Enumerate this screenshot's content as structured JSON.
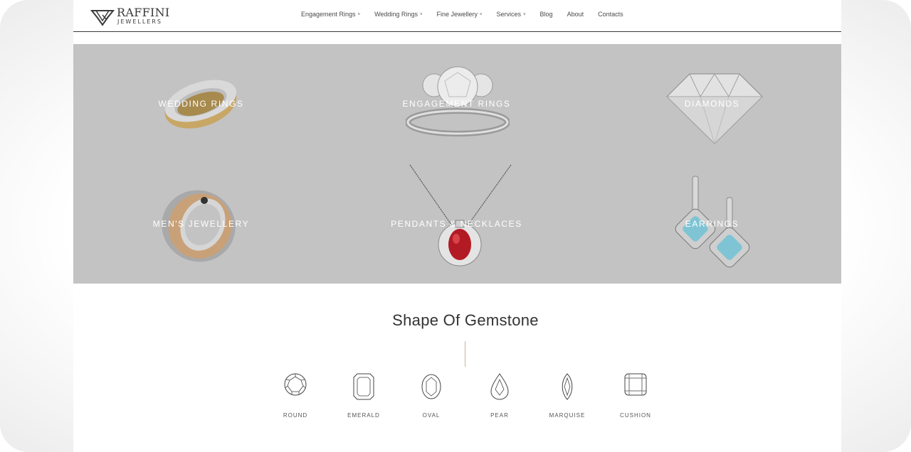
{
  "brand": {
    "name": "RAFFINI",
    "sub": "JEWELLERS"
  },
  "nav": {
    "items": [
      {
        "label": "Engagement Rings",
        "dropdown": true
      },
      {
        "label": "Wedding Rings",
        "dropdown": true
      },
      {
        "label": "Fine Jewellery",
        "dropdown": true
      },
      {
        "label": "Services",
        "dropdown": true
      },
      {
        "label": "Blog",
        "dropdown": false
      },
      {
        "label": "About",
        "dropdown": false
      },
      {
        "label": "Contacts",
        "dropdown": false
      }
    ],
    "caret": "˅"
  },
  "categories": [
    {
      "label": "WEDDING RINGS",
      "icon": "wedding-ring-image"
    },
    {
      "label": "ENGAGEMENT RINGS",
      "icon": "engagement-ring-image"
    },
    {
      "label": "DIAMONDS",
      "icon": "diamond-image"
    },
    {
      "label": "MEN'S JEWELLERY",
      "icon": "mens-ring-image"
    },
    {
      "label": "PENDANTS & NECKLACES",
      "icon": "ruby-pendant-image"
    },
    {
      "label": "EARRINGS",
      "icon": "blue-topaz-earrings-image"
    }
  ],
  "shapes_section": {
    "title": "Shape Of Gemstone",
    "shapes": [
      {
        "label": "ROUND",
        "icon": "round-cut-icon"
      },
      {
        "label": "EMERALD",
        "icon": "emerald-cut-icon"
      },
      {
        "label": "OVAL",
        "icon": "oval-cut-icon"
      },
      {
        "label": "PEAR",
        "icon": "pear-cut-icon"
      },
      {
        "label": "MARQUISE",
        "icon": "marquise-cut-icon"
      },
      {
        "label": "CUSHION",
        "icon": "cushion-cut-icon"
      }
    ]
  },
  "colors": {
    "grid_overlay": "#c3c3c3",
    "divider_gold": "#c9b79a",
    "text_dark": "#333333"
  }
}
